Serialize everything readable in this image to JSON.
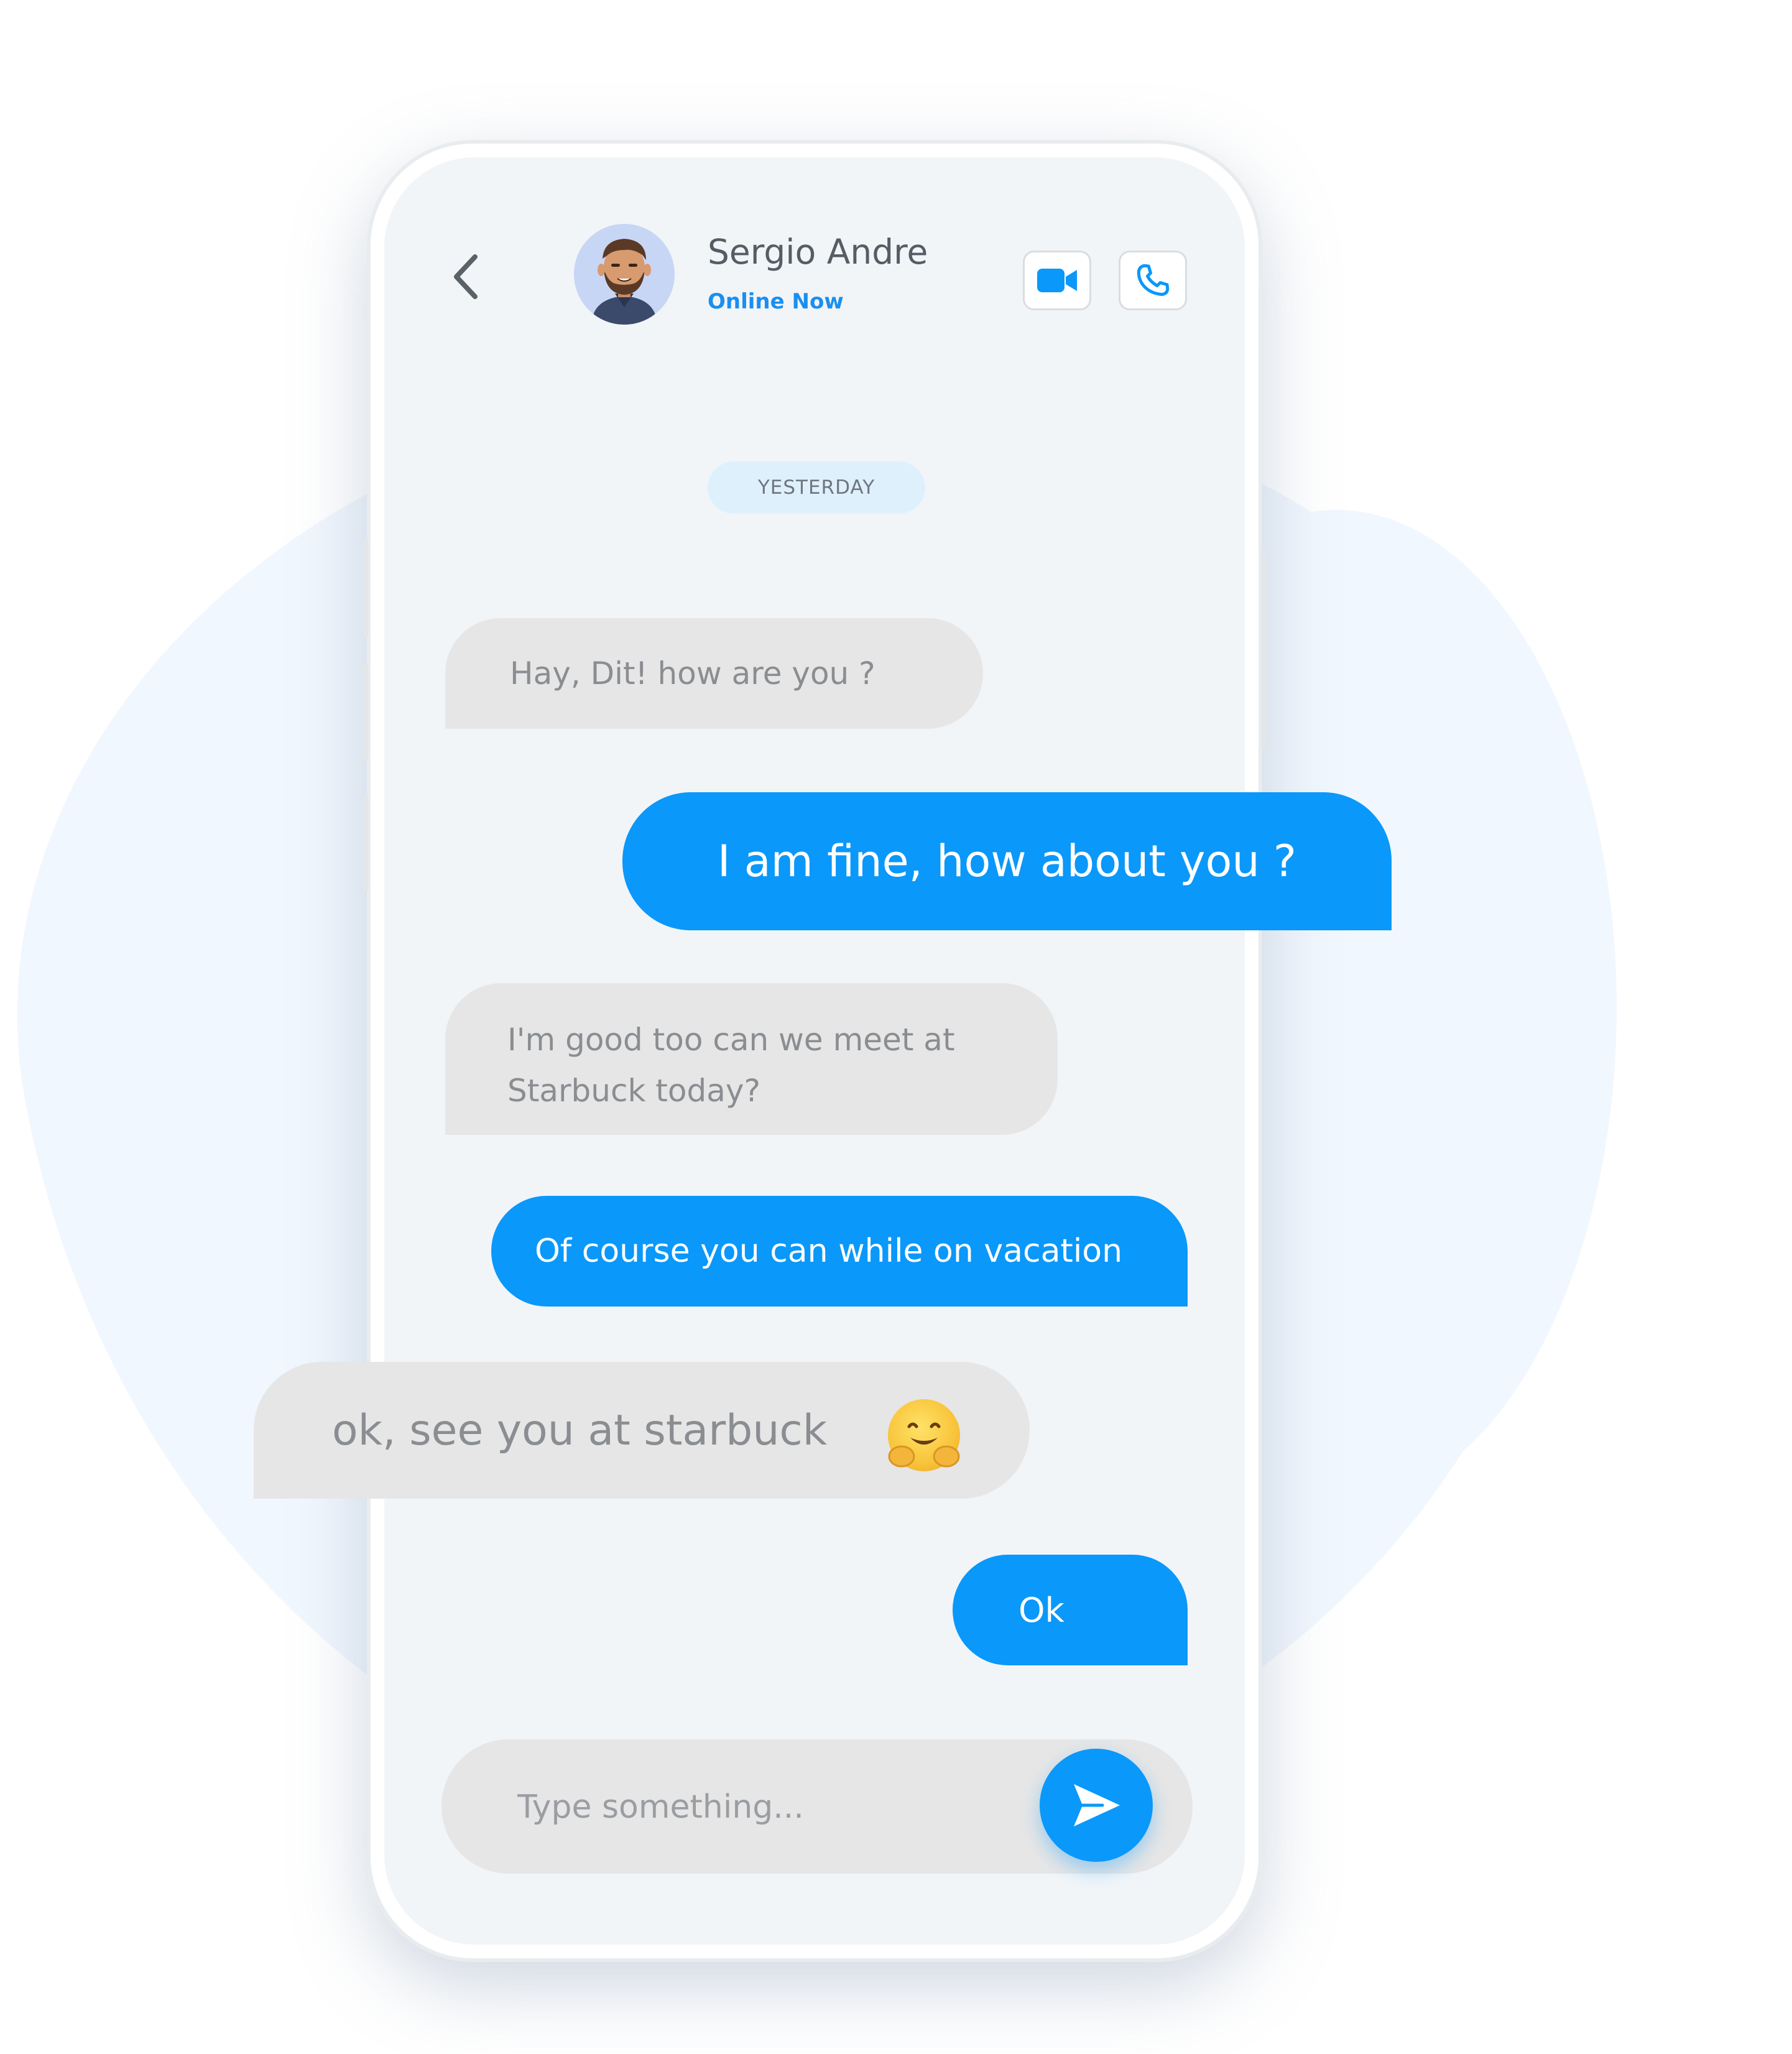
{
  "header": {
    "contact_name": "Sergio Andre",
    "status": "Online Now",
    "back_icon": "chevron-left-icon",
    "video_icon": "video-camera-icon",
    "call_icon": "phone-icon"
  },
  "date_divider": "YESTERDAY",
  "messages": [
    {
      "direction": "incoming",
      "text": "Hay, Dit! how are you ?"
    },
    {
      "direction": "outgoing",
      "text": "I am fine, how about you ?"
    },
    {
      "direction": "incoming",
      "text_line1": "I'm good too can we meet at",
      "text_line2": "Starbuck today?"
    },
    {
      "direction": "outgoing",
      "text": "Of course you can while on vacation"
    },
    {
      "direction": "incoming",
      "text": "ok, see you at starbuck",
      "emoji": "hugging-face-emoji"
    },
    {
      "direction": "outgoing",
      "text": "Ok"
    }
  ],
  "composer": {
    "placeholder": "Type something...",
    "send_icon": "send-icon"
  },
  "colors": {
    "accent": "#0a98fa",
    "incoming_bubble": "#e6e6e6",
    "screen_bg": "#f1f5f8",
    "status_text": "#1a8ff0"
  }
}
